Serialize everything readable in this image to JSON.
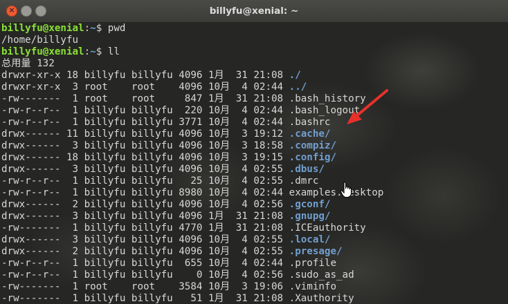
{
  "window": {
    "title": "billyfu@xenial: ~"
  },
  "terminal": {
    "prompts": [
      {
        "user": "billyfu@xenial",
        "sep": ":",
        "path": "~",
        "sym": "$ ",
        "cmd": "pwd"
      },
      {
        "user": "billyfu@xenial",
        "sep": ":",
        "path": "~",
        "sym": "$ ",
        "cmd": "ll"
      }
    ],
    "pwd_output": "/home/billyfu",
    "total": "总用量 132",
    "listing": [
      {
        "meta": "drwxr-xr-x 18 billyfu billyfu 4096 1月  31 21:08 ",
        "name": "./",
        "dir": true
      },
      {
        "meta": "drwxr-xr-x  3 root    root    4096 10月  4 02:44 ",
        "name": "../",
        "dir": true
      },
      {
        "meta": "-rw-------  1 root    root     847 1月  31 21:08 ",
        "name": ".bash_history",
        "dir": false
      },
      {
        "meta": "-rw-r--r--  1 billyfu billyfu  220 10月  4 02:44 ",
        "name": ".bash_logout",
        "dir": false
      },
      {
        "meta": "-rw-r--r--  1 billyfu billyfu 3771 10月  4 02:44 ",
        "name": ".bashrc",
        "dir": false
      },
      {
        "meta": "drwx------ 11 billyfu billyfu 4096 10月  3 19:12 ",
        "name": ".cache/",
        "dir": true
      },
      {
        "meta": "drwx------  3 billyfu billyfu 4096 10月  3 18:58 ",
        "name": ".compiz/",
        "dir": true
      },
      {
        "meta": "drwx------ 18 billyfu billyfu 4096 10月  3 19:15 ",
        "name": ".config/",
        "dir": true
      },
      {
        "meta": "drwx------  3 billyfu billyfu 4096 10月  4 02:55 ",
        "name": ".dbus/",
        "dir": true
      },
      {
        "meta": "-rw-r--r--  1 billyfu billyfu   25 10月  4 02:55 ",
        "name": ".dmrc",
        "dir": false
      },
      {
        "meta": "-rw-r--r--  1 billyfu billyfu 8980 10月  4 02:44 ",
        "name": "examples.desktop",
        "dir": false
      },
      {
        "meta": "drwx------  2 billyfu billyfu 4096 10月  4 02:56 ",
        "name": ".gconf/",
        "dir": true
      },
      {
        "meta": "drwx------  3 billyfu billyfu 4096 1月  31 21:08 ",
        "name": ".gnupg/",
        "dir": true
      },
      {
        "meta": "-rw-------  1 billyfu billyfu 4770 1月  31 21:08 ",
        "name": ".ICEauthority",
        "dir": false
      },
      {
        "meta": "drwx------  3 billyfu billyfu 4096 10月  4 02:55 ",
        "name": ".local/",
        "dir": true
      },
      {
        "meta": "drwx------  2 billyfu billyfu 4096 10月  4 02:55 ",
        "name": ".presage/",
        "dir": true
      },
      {
        "meta": "-rw-r--r--  1 billyfu billyfu  655 10月  4 02:44 ",
        "name": ".profile",
        "dir": false
      },
      {
        "meta": "-rw-r--r--  1 billyfu billyfu    0 10月  4 02:56 ",
        "name": ".sudo_as_ad",
        "dir": false
      },
      {
        "meta": "-rw-------  1 root    root    3584 10月  3 19:06 ",
        "name": ".viminfo",
        "dir": false
      },
      {
        "meta": "-rw-------  1 billyfu billyfu   51 1月  31 21:08 ",
        "name": ".Xauthority",
        "dir": false
      }
    ],
    "colors": {
      "prompt_user": "#8ae234",
      "prompt_path": "#729fcf",
      "dir": "#729fcf",
      "text": "#d8d8d8"
    }
  },
  "icons": {
    "arrow": "red-arrow-annotation",
    "cursor": "hand-pointer-icon"
  }
}
